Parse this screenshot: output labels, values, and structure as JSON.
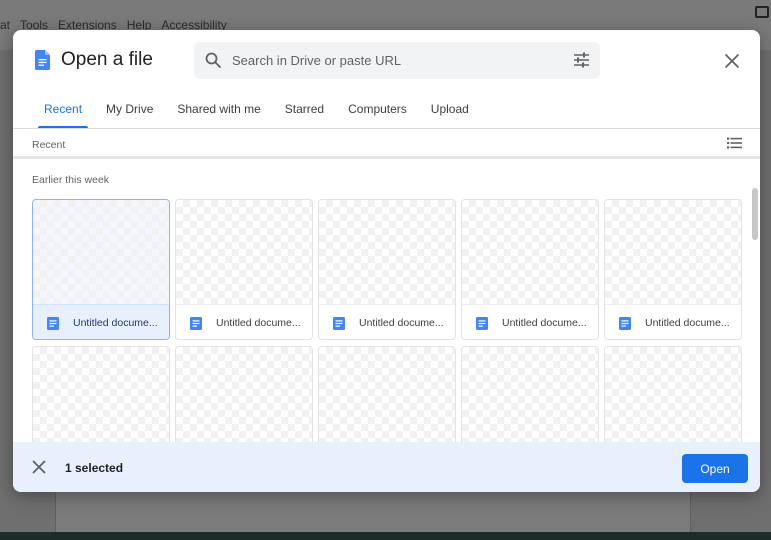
{
  "background_app": {
    "menu_items": [
      "at",
      "Tools",
      "Extensions",
      "Help",
      "Accessibility"
    ]
  },
  "dialog": {
    "title": "Open a file",
    "logo_icon": "google-docs-icon",
    "search": {
      "placeholder": "Search in Drive or paste URL",
      "value": ""
    },
    "tabs": [
      {
        "label": "Recent",
        "active": true
      },
      {
        "label": "My Drive",
        "active": false
      },
      {
        "label": "Shared with me",
        "active": false
      },
      {
        "label": "Starred",
        "active": false
      },
      {
        "label": "Computers",
        "active": false
      },
      {
        "label": "Upload",
        "active": false
      }
    ],
    "breadcrumb": "Recent",
    "section_label": "Earlier this week",
    "files": [
      {
        "name": "Untitled docume...",
        "selected": true
      },
      {
        "name": "Untitled docume...",
        "selected": false
      },
      {
        "name": "Untitled docume...",
        "selected": false
      },
      {
        "name": "Untitled docume...",
        "selected": false
      },
      {
        "name": "Untitled docume...",
        "selected": false
      }
    ],
    "selection_text": "1 selected",
    "open_label": "Open"
  },
  "colors": {
    "accent": "#1a73e8",
    "doc_icon": "#4285f4",
    "footer_bg": "#e8f0fe"
  }
}
